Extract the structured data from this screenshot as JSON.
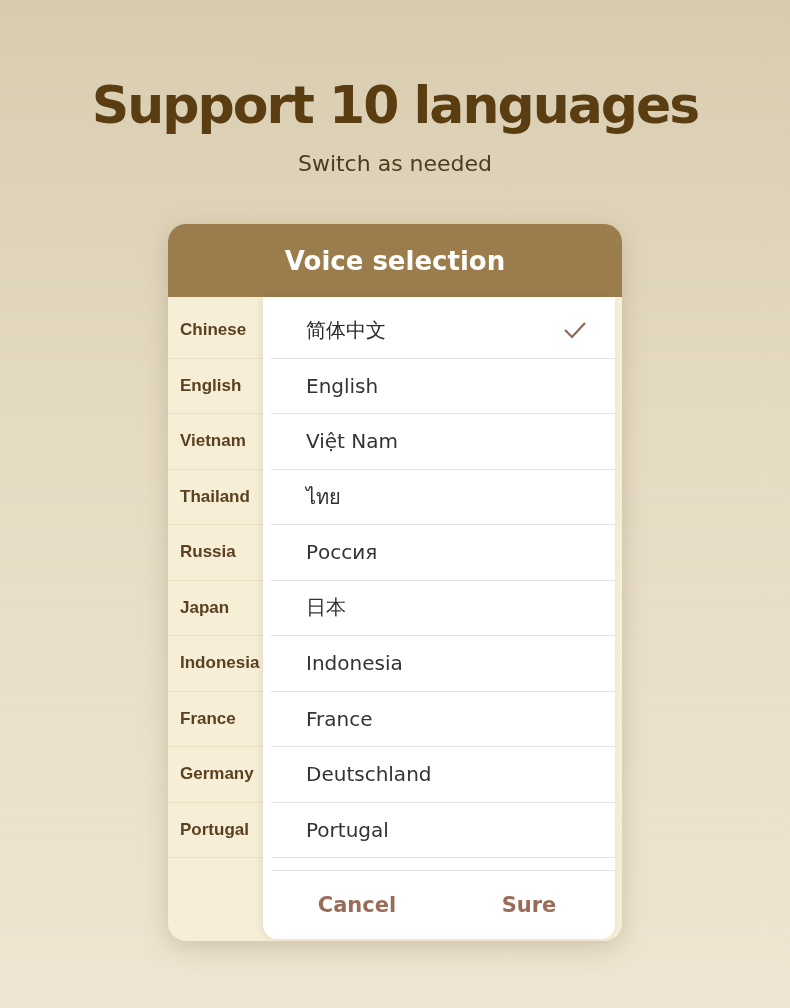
{
  "headline": "Support 10 languages",
  "subtitle": "Switch as needed",
  "dialog": {
    "title": "Voice selection",
    "languages": [
      {
        "label": "Chinese",
        "native": "简体中文",
        "selected": true
      },
      {
        "label": "English",
        "native": "English",
        "selected": false
      },
      {
        "label": "Vietnam",
        "native": "Việt Nam",
        "selected": false
      },
      {
        "label": "Thailand",
        "native": "ไทย",
        "selected": false
      },
      {
        "label": "Russia",
        "native": "Россия",
        "selected": false
      },
      {
        "label": "Japan",
        "native": "日本",
        "selected": false
      },
      {
        "label": "Indonesia",
        "native": "Indonesia",
        "selected": false
      },
      {
        "label": "France",
        "native": "France",
        "selected": false
      },
      {
        "label": "Germany",
        "native": "Deutschland",
        "selected": false
      },
      {
        "label": "Portugal",
        "native": "Portugal",
        "selected": false
      }
    ],
    "buttons": [
      "Cancel",
      "Sure"
    ]
  }
}
